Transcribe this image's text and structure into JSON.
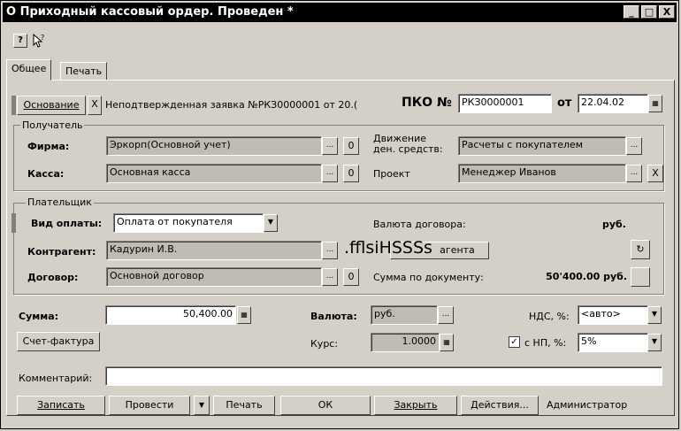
{
  "window": {
    "title": "О Приходный кассовый ордер. Проведен *",
    "controls": [
      "_",
      "□",
      "X"
    ]
  },
  "toolbar": {
    "help_icon": "?",
    "pointer_icon": "?"
  },
  "tabs": [
    {
      "label": "Общее"
    },
    {
      "label": "Печать"
    }
  ],
  "header": {
    "basis_button": "Основание",
    "basis_clear": "X",
    "basis_text": "Неподтвержденная заявка №РКЗ0000001 от 20.(",
    "pko_label": "ПКО №",
    "pko_number": "РКЗ0000001",
    "date_label": "от",
    "date_value": "22.04.02"
  },
  "recipient": {
    "group_label": "Получатель",
    "firm_label": "Фирма:",
    "firm_value": "Эркорп(Основной учет)",
    "cash_label": "Касса:",
    "cash_value": "Основная касса",
    "movement_label": "Движение\nден. средств:",
    "movement_value": "Расчеты с покупателем",
    "project_label": "Проект",
    "project_value": "Менеджер Иванов"
  },
  "payer": {
    "group_label": "Плательщик",
    "payment_type_label": "Вид оплаты:",
    "payment_type_value": "Оплата от покупателя",
    "contract_currency_label": "Валюта договора:",
    "contract_currency_value": "руб.",
    "counterparty_label": "Контрагент:",
    "counterparty_value": "Кадурин И.В.",
    "counterparty_button": "агента",
    "overlay_text": ".fflsiHSSSs",
    "contract_label": "Договор:",
    "contract_value": "Основной договор",
    "doc_sum_label": "Сумма по документу:",
    "doc_sum_value": "50'400.00 руб."
  },
  "amounts": {
    "sum_label": "Сумма:",
    "sum_value": "50,400.00",
    "invoice_button": "Счет-фактура",
    "currency_label": "Валюта:",
    "currency_value": "руб.",
    "rate_label": "Курс:",
    "rate_value": "1.0000",
    "vat_label": "НДС, %:",
    "vat_value": "<авто>",
    "np_label": "с НП, %:",
    "np_checked": "✓",
    "np_value": "5%"
  },
  "comment": {
    "label": "Комментарий:",
    "value": ""
  },
  "footer": {
    "save_button": "Записать",
    "post_button": "Провести",
    "post_arrow": "▼",
    "print_button": "Печать",
    "ok_button": "ОК",
    "close_button": "Закрыть",
    "actions_button": "Действия...",
    "user": "Администратор"
  }
}
